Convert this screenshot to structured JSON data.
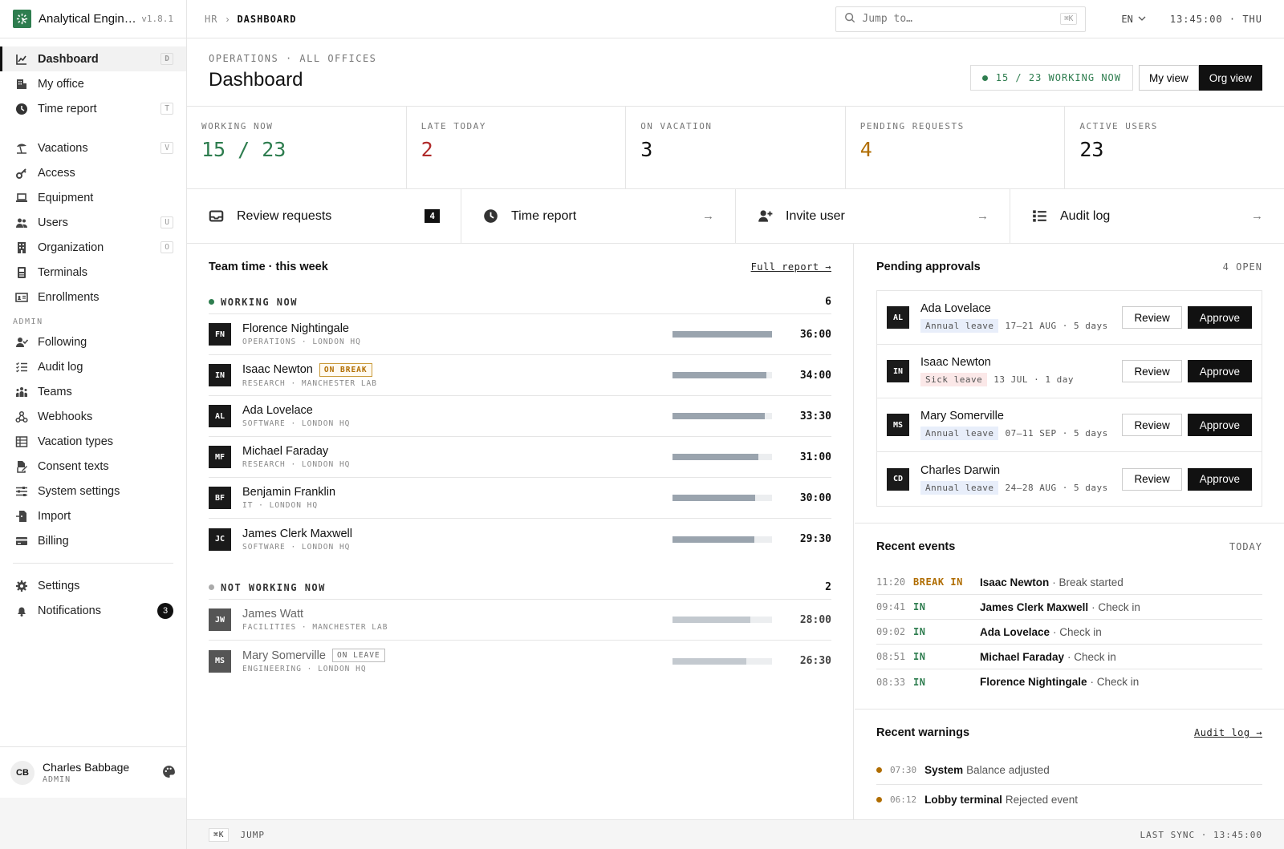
{
  "app": {
    "name": "Analytical Engin…",
    "version": "v1.8.1",
    "accent": "#2e7d4f"
  },
  "sidebar": {
    "main": [
      {
        "label": "Dashboard",
        "icon": "chart-line-icon",
        "kbd": "D",
        "active": true
      },
      {
        "label": "My office",
        "icon": "office-icon"
      },
      {
        "label": "Time report",
        "icon": "clock-icon",
        "kbd": "T"
      }
    ],
    "secondary": [
      {
        "label": "Vacations",
        "icon": "beach-icon",
        "kbd": "V"
      },
      {
        "label": "Access",
        "icon": "key-icon"
      },
      {
        "label": "Equipment",
        "icon": "laptop-icon"
      },
      {
        "label": "Users",
        "icon": "users-icon",
        "kbd": "U"
      },
      {
        "label": "Organization",
        "icon": "building-icon",
        "kbd": "O"
      },
      {
        "label": "Terminals",
        "icon": "terminal-icon"
      },
      {
        "label": "Enrollments",
        "icon": "id-card-icon"
      }
    ],
    "admin_heading": "ADMIN",
    "admin": [
      {
        "label": "Following",
        "icon": "user-check-icon"
      },
      {
        "label": "Audit log",
        "icon": "list-check-icon"
      },
      {
        "label": "Teams",
        "icon": "people-group-icon"
      },
      {
        "label": "Webhooks",
        "icon": "webhook-icon"
      },
      {
        "label": "Vacation types",
        "icon": "table-icon"
      },
      {
        "label": "Consent texts",
        "icon": "file-signature-icon"
      },
      {
        "label": "System settings",
        "icon": "sliders-icon"
      },
      {
        "label": "Import",
        "icon": "file-import-icon"
      },
      {
        "label": "Billing",
        "icon": "credit-card-icon"
      }
    ],
    "bottom": [
      {
        "label": "Settings",
        "icon": "gear-icon"
      },
      {
        "label": "Notifications",
        "icon": "bell-icon",
        "count": "3"
      }
    ],
    "user": {
      "initials": "CB",
      "name": "Charles Babbage",
      "role": "ADMIN"
    }
  },
  "topbar": {
    "crumb_root": "HR",
    "crumb_sep": "›",
    "crumb_current": "DASHBOARD",
    "search_placeholder": "Jump to…",
    "search_kbd": "⌘K",
    "lang": "EN",
    "clock": "13:45:00 · THU"
  },
  "page": {
    "eyebrow": "OPERATIONS · ALL OFFICES",
    "title": "Dashboard",
    "working_pill": "15 / 23 WORKING NOW",
    "view_my": "My view",
    "view_org": "Org view"
  },
  "stats": [
    {
      "label": "WORKING NOW",
      "value": "15 / 23",
      "color": "#2e7d4f"
    },
    {
      "label": "LATE TODAY",
      "value": "2",
      "color": "#b02a2a"
    },
    {
      "label": "ON VACATION",
      "value": "3",
      "color": "#111111"
    },
    {
      "label": "PENDING REQUESTS",
      "value": "4",
      "color": "#b06d00"
    },
    {
      "label": "ACTIVE USERS",
      "value": "23",
      "color": "#111111"
    }
  ],
  "actions": [
    {
      "label": "Review requests",
      "icon": "inbox-icon",
      "count": "4"
    },
    {
      "label": "Time report",
      "icon": "clock-icon",
      "arrow": "→"
    },
    {
      "label": "Invite user",
      "icon": "user-plus-icon",
      "arrow": "→"
    },
    {
      "label": "Audit log",
      "icon": "list-icon",
      "arrow": "→"
    }
  ],
  "team": {
    "title": "Team time · this week",
    "link": "Full report →",
    "working_label": "WORKING NOW",
    "working_count": "6",
    "working": [
      {
        "initials": "FN",
        "name": "Florence Nightingale",
        "sub": "OPERATIONS · LONDON HQ",
        "hours": "36:00",
        "fill": 1.0
      },
      {
        "initials": "IN",
        "name": "Isaac Newton",
        "sub": "RESEARCH · MANCHESTER LAB",
        "hours": "34:00",
        "fill": 0.94,
        "tag": "ON BREAK"
      },
      {
        "initials": "AL",
        "name": "Ada Lovelace",
        "sub": "SOFTWARE · LONDON HQ",
        "hours": "33:30",
        "fill": 0.93
      },
      {
        "initials": "MF",
        "name": "Michael Faraday",
        "sub": "RESEARCH · LONDON HQ",
        "hours": "31:00",
        "fill": 0.86
      },
      {
        "initials": "BF",
        "name": "Benjamin Franklin",
        "sub": "IT · LONDON HQ",
        "hours": "30:00",
        "fill": 0.83
      },
      {
        "initials": "JC",
        "name": "James Clerk Maxwell",
        "sub": "SOFTWARE · LONDON HQ",
        "hours": "29:30",
        "fill": 0.82
      }
    ],
    "idle_label": "NOT WORKING NOW",
    "idle_count": "2",
    "idle": [
      {
        "initials": "JW",
        "name": "James Watt",
        "sub": "FACILITIES · MANCHESTER LAB",
        "hours": "28:00",
        "fill": 0.78
      },
      {
        "initials": "MS",
        "name": "Mary Somerville",
        "sub": "ENGINEERING · LONDON HQ",
        "hours": "26:30",
        "fill": 0.74,
        "tag": "ON LEAVE"
      }
    ]
  },
  "approvals": {
    "title": "Pending approvals",
    "meta": "4 OPEN",
    "review": "Review",
    "approve": "Approve",
    "items": [
      {
        "initials": "AL",
        "name": "Ada Lovelace",
        "type": "Annual leave",
        "kind": "annual",
        "dates": "17–21 AUG · 5 days"
      },
      {
        "initials": "IN",
        "name": "Isaac Newton",
        "type": "Sick leave",
        "kind": "sick",
        "dates": "13 JUL · 1 day"
      },
      {
        "initials": "MS",
        "name": "Mary Somerville",
        "type": "Annual leave",
        "kind": "annual",
        "dates": "07–11 SEP · 5 days"
      },
      {
        "initials": "CD",
        "name": "Charles Darwin",
        "type": "Annual leave",
        "kind": "annual",
        "dates": "24–28 AUG · 5 days"
      }
    ]
  },
  "events": {
    "title": "Recent events",
    "meta": "TODAY",
    "items": [
      {
        "time": "11:20",
        "type": "BREAK IN",
        "color": "#b06d00",
        "who": "Isaac Newton",
        "what": "· Break started"
      },
      {
        "time": "09:41",
        "type": "IN",
        "color": "#2e7d4f",
        "who": "James Clerk Maxwell",
        "what": "· Check in"
      },
      {
        "time": "09:02",
        "type": "IN",
        "color": "#2e7d4f",
        "who": "Ada Lovelace",
        "what": "· Check in"
      },
      {
        "time": "08:51",
        "type": "IN",
        "color": "#2e7d4f",
        "who": "Michael Faraday",
        "what": "· Check in"
      },
      {
        "time": "08:33",
        "type": "IN",
        "color": "#2e7d4f",
        "who": "Florence Nightingale",
        "what": "· Check in"
      }
    ]
  },
  "warnings": {
    "title": "Recent warnings",
    "link": "Audit log →",
    "items": [
      {
        "time": "07:30",
        "who": "System",
        "what": "Balance adjusted"
      },
      {
        "time": "06:12",
        "who": "Lobby terminal",
        "what": "Rejected event"
      }
    ]
  },
  "footer": {
    "kbd": "⌘K",
    "jump": "JUMP",
    "sync": "LAST SYNC · 13:45:00"
  }
}
